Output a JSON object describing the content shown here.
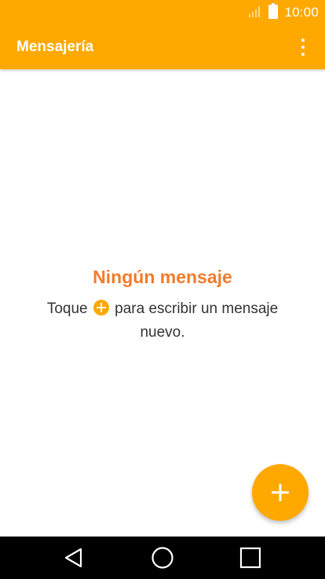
{
  "status_bar": {
    "time": "10:00",
    "icons": [
      "signal-icon",
      "battery-icon"
    ]
  },
  "app_bar": {
    "title": "Mensajería",
    "menu_icon": "more-vert-icon"
  },
  "empty_state": {
    "title": "Ningún mensaje",
    "text_before_icon": "Toque ",
    "inline_icon": "add-circle-icon",
    "text_after_icon": " para escribir un mensaje nuevo."
  },
  "fab": {
    "icon": "plus-icon"
  },
  "nav_bar": {
    "buttons": [
      "back-icon",
      "home-icon",
      "recents-icon"
    ]
  },
  "colors": {
    "accent": "#ffa800",
    "empty_title": "#f07c2c",
    "nav_bar": "#000000"
  }
}
